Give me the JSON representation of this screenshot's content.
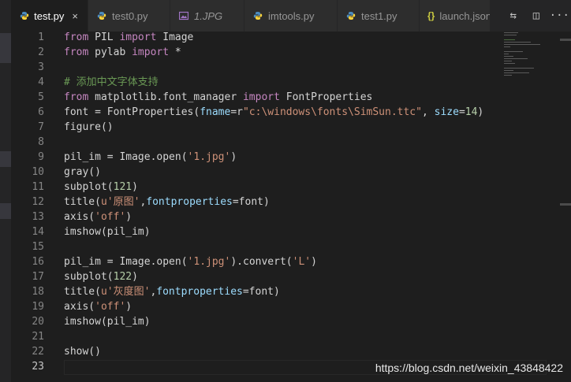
{
  "tabs": [
    {
      "label": "test.py",
      "icon": "python-icon",
      "active": true,
      "close": "×"
    },
    {
      "label": "test0.py",
      "icon": "python-icon",
      "active": false
    },
    {
      "label": "1.JPG",
      "icon": "image-icon",
      "active": false
    },
    {
      "label": "imtools.py",
      "icon": "python-icon",
      "active": false
    },
    {
      "label": "test1.py",
      "icon": "python-icon",
      "active": false
    },
    {
      "label": "launch.json",
      "icon": "json-braces-icon",
      "active": false,
      "icon_glyph": "{}"
    }
  ],
  "tab_actions": [
    {
      "name": "open-changes-icon",
      "glyph": "⇆"
    },
    {
      "name": "split-editor-icon",
      "glyph": "◫"
    },
    {
      "name": "more-actions-icon",
      "glyph": "···"
    }
  ],
  "editor": {
    "line_numbers": [
      "1",
      "2",
      "3",
      "4",
      "5",
      "6",
      "7",
      "8",
      "9",
      "10",
      "11",
      "12",
      "13",
      "14",
      "15",
      "16",
      "17",
      "18",
      "19",
      "20",
      "21",
      "22",
      "23"
    ],
    "current_line": "23",
    "lines": {
      "l1": {
        "kw1": "from",
        "t1": " PIL ",
        "kw2": "import",
        "t2": " Image"
      },
      "l2": {
        "kw1": "from",
        "t1": " pylab ",
        "kw2": "import",
        "t2": " *"
      },
      "l4": {
        "cmt": "# 添加中文字体支持"
      },
      "l5": {
        "kw1": "from",
        "t1": " matplotlib.font_manager ",
        "kw2": "import",
        "t2": " FontProperties"
      },
      "l6": {
        "t1": "font = FontProperties(",
        "p1": "fname",
        "t2": "=r",
        "s1": "\"c:\\windows\\fonts\\SimSun.ttc\"",
        "t3": ", ",
        "p2": "size",
        "t4": "=",
        "n1": "14",
        "t5": ")"
      },
      "l7": {
        "t1": "figure()"
      },
      "l9": {
        "t1": "pil_im = Image.open(",
        "s1": "'1.jpg'",
        "t2": ")"
      },
      "l10": {
        "t1": "gray()"
      },
      "l11": {
        "t1": "subplot(",
        "n1": "121",
        "t2": ")"
      },
      "l12": {
        "t1": "title(",
        "s1": "u'原图'",
        "t2": ",",
        "p1": "fontproperties",
        "t3": "=font)"
      },
      "l13": {
        "t1": "axis(",
        "s1": "'off'",
        "t2": ")"
      },
      "l14": {
        "t1": "imshow(pil_im)"
      },
      "l16": {
        "t1": "pil_im = Image.open(",
        "s1": "'1.jpg'",
        "t2": ").convert(",
        "s2": "'L'",
        "t3": ")"
      },
      "l17": {
        "t1": "subplot(",
        "n1": "122",
        "t2": ")"
      },
      "l18": {
        "t1": "title(",
        "s1": "u'灰度图'",
        "t2": ",",
        "p1": "fontproperties",
        "t3": "=font)"
      },
      "l19": {
        "t1": "axis(",
        "s1": "'off'",
        "t2": ")"
      },
      "l20": {
        "t1": "imshow(pil_im)"
      },
      "l22": {
        "t1": "show()"
      }
    }
  },
  "colors": {
    "keyword": "#c586c0",
    "string": "#ce9178",
    "number": "#b5cea8",
    "comment": "#6a9955",
    "param": "#9cdcfe",
    "text": "#d4d4d4"
  },
  "watermark": "https://blog.csdn.net/weixin_43848422"
}
